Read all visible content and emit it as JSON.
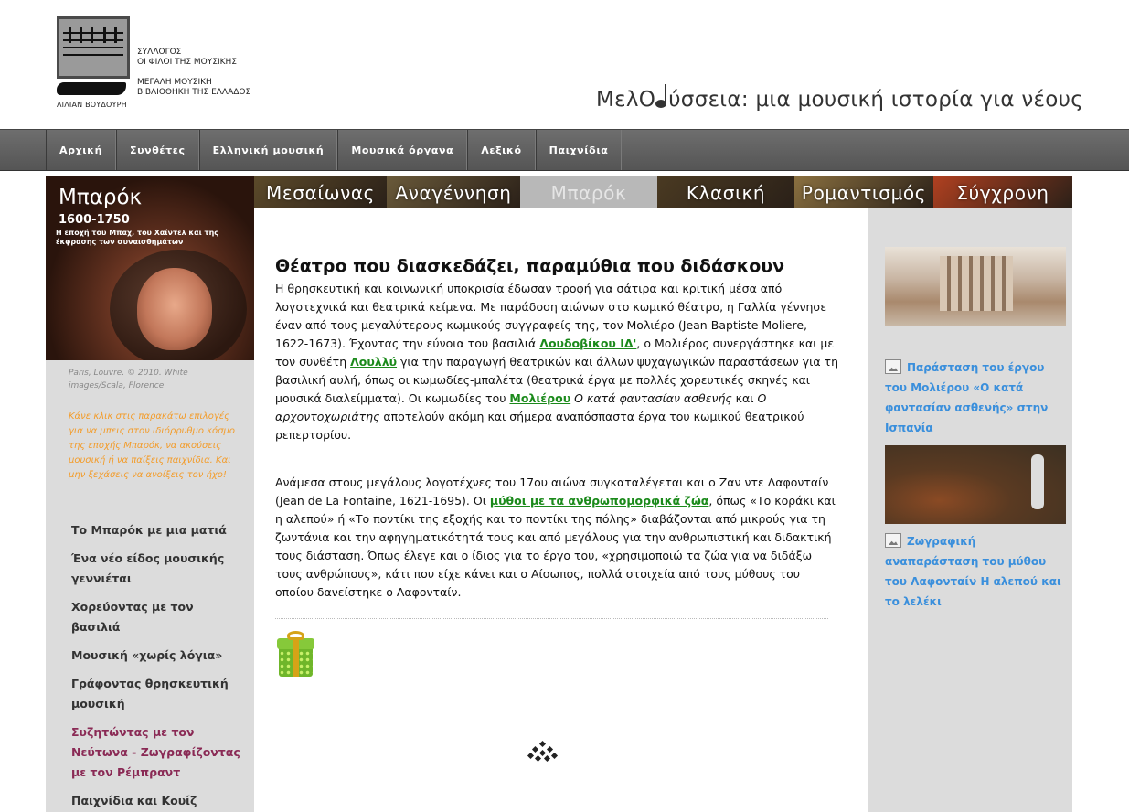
{
  "header": {
    "logo_name": "ΛΙΛΙΑΝ ΒΟΥΔΟΥΡΗ",
    "org_line1": "ΣΥΛΛΟΓΟΣ",
    "org_line2": "ΟΙ ΦΙΛΟΙ ΤΗΣ ΜΟΥΣΙΚΗΣ",
    "org_line3": "ΜΕΓΑΛΗ ΜΟΥΣΙΚΗ",
    "org_line4": "ΒΙΒΛΙΟΘΗΚΗ ΤΗΣ ΕΛΛΑΔΟΣ",
    "site_title_pre": "ΜελΟ",
    "site_title_post": "ύσσεια: μια μουσική ιστορία για νέους"
  },
  "nav": {
    "items": [
      {
        "label": "Αρχική"
      },
      {
        "label": "Συνθέτες"
      },
      {
        "label": "Ελληνική μουσική"
      },
      {
        "label": "Μουσικά όργανα"
      },
      {
        "label": "Λεξικό"
      },
      {
        "label": "Παιχνίδια"
      }
    ]
  },
  "sidebar": {
    "period_title": "Μπαρόκ",
    "period_years": "1600-1750",
    "period_subtitle": "Η εποχή του Μπαχ, του Χαίντελ και της έκφρασης των συναισθημάτων",
    "image_credit": "Paris, Louvre. © 2010. White images/Scala, Florence",
    "promo_text": "Κάνε κλικ στις παρακάτω επιλογές για να μπεις στον ιδιόρρυθμο κόσμο της εποχής Μπαρόκ, να ακούσεις μουσική ή να παίξεις παιχνίδια. Και μην ξεχάσεις να ανοίξεις τον ήχο!",
    "menu": [
      {
        "label": "Το Μπαρόκ με μια ματιά"
      },
      {
        "label": "Ένα νέο είδος μουσικής γεννιέται"
      },
      {
        "label": "Χορεύοντας με τον βασιλιά"
      },
      {
        "label": "Μουσική «χωρίς λόγια»"
      },
      {
        "label": "Γράφοντας θρησκευτική μουσική"
      },
      {
        "label": "Συζητώντας με τον Νεύτωνα - Ζωγραφίζοντας με τον Ρέμπραντ"
      },
      {
        "label": "Παιχνίδια και Κουίζ"
      }
    ]
  },
  "tabs": [
    {
      "label": "Μεσαίωνας",
      "color": "#5c4a2a"
    },
    {
      "label": "Αναγέννηση",
      "color": "#6a5a3a"
    },
    {
      "label": "Μπαρόκ",
      "color": "#b8b8b8"
    },
    {
      "label": "Κλασική",
      "color": "#4a3a22"
    },
    {
      "label": "Ρομαντισμός",
      "color": "#8a7040"
    },
    {
      "label": "Σύγχρονη",
      "color": "#b04020"
    }
  ],
  "article": {
    "title": "Θέατρο που διασκεδάζει, παραμύθια που διδάσκουν",
    "p1": {
      "t1": "Η θρησκευτική και κοινωνική υποκρισία έδωσαν τροφή για σάτιρα και κριτική μέσα από λογοτεχνικά και θεατρικά κείμενα. Με παράδοση αιώνων στο κωμικό θέατρο, η Γαλλία γέννησε έναν από τους μεγαλύτερους κωμικούς συγγραφείς της, τον Μολιέρο (Jean-Baptiste Moliere, 1622-1673). Έχοντας την εύνοια του βασιλιά ",
      "link1": "Λουδοβίκου ΙΔ'",
      "t2": ", ο Μολιέρος συνεργάστηκε και με τον συνθέτη ",
      "link2": "Λουλλύ",
      "t3": " για την παραγωγή θεατρικών και άλλων ψυχαγωγικών παραστάσεων για τη βασιλική αυλή, όπως οι κωμωδίες-μπαλέτα (θεατρικά έργα με πολλές χορευτικές σκηνές και μουσικά διαλείμματα). Οι κωμωδίες του ",
      "link3": "Μολιέρου",
      "t4": " ",
      "em1": "Ο κατά φαντασίαν ασθενής",
      "t5": " και ",
      "em2": "Ο αρχοντοχωριάτης",
      "t6": " αποτελούν ακόμη και σήμερα αναπόσπαστα έργα του κωμικού θεατρικού ρεπερτορίου."
    },
    "p2": {
      "t1": "Ανάμεσα στους μεγάλους λογοτέχνες του 17ου αιώνα συγκαταλέγεται και ο Ζαν ντε Λαφονταίν (Jean de La Fontaine, 1621-1695). Οι ",
      "link1": "μύθοι με τα ανθρωπομορφικά ζώα",
      "t2": ", όπως «Το κοράκι και η αλεπού» ή «Το ποντίκι της εξοχής και το ποντίκι της πόλης» διαβάζονται από μικρούς για τη ζωντάνια και την αφηγηματικότητά τους και από μεγάλους για την ανθρωπιστική και διδακτική τους διάσταση. Όπως έλεγε και ο ίδιος για το έργο του, «χρησιμοποιώ τα ζώα για να διδάξω τους ανθρώπους», κάτι που είχε κάνει και ο Αίσωπος, πολλά στοιχεία από τους μύθους του οποίου δανείστηκε ο Λαφονταίν."
    }
  },
  "right": {
    "caption1": "Παράσταση του έργου του Μολιέρου «Ο κατά φαντασίαν ασθενής» στην Ισπανία",
    "caption2": "Ζωγραφική αναπαράσταση του μύθου του Λαφονταίν Η αλεπού και το λελέκι"
  },
  "colors": {
    "link_green": "#1b8a1b",
    "caption_blue": "#3a8fdc",
    "promo_orange": "#f39c2a",
    "menu_alt": "#8a2a55"
  }
}
